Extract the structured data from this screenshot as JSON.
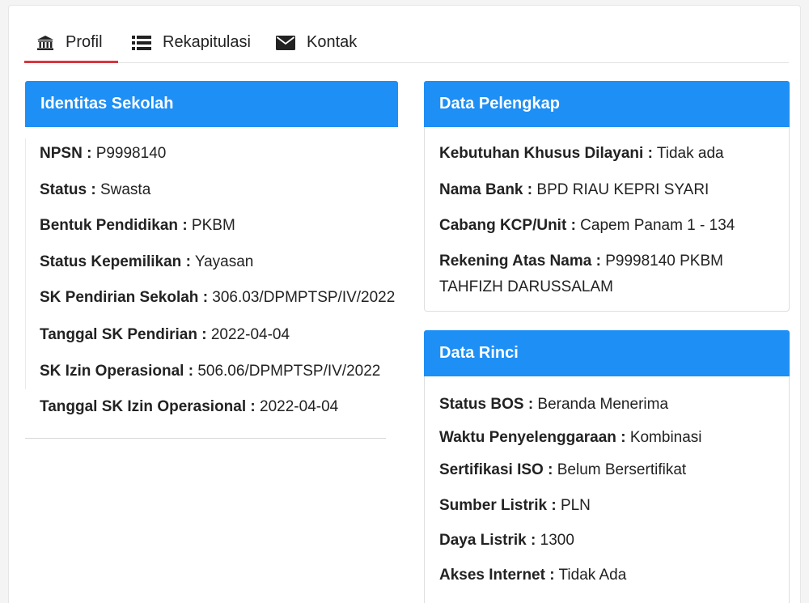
{
  "tabs": [
    {
      "label": "Profil",
      "icon": "bank-icon",
      "active": true
    },
    {
      "label": "Rekapitulasi",
      "icon": "list-icon",
      "active": false
    },
    {
      "label": "Kontak",
      "icon": "envelope-icon",
      "active": false
    }
  ],
  "colors": {
    "accent": "#1e8ff5",
    "active_tab": "#d9363e"
  },
  "identitas": {
    "title": "Identitas Sekolah",
    "fields": [
      {
        "label": "NPSN",
        "value": "P9998140"
      },
      {
        "label": "Status",
        "value": "Swasta"
      },
      {
        "label": "Bentuk Pendidikan",
        "value": "PKBM"
      },
      {
        "label": "Status Kepemilikan",
        "value": "Yayasan"
      },
      {
        "label": "SK Pendirian Sekolah",
        "value": "306.03/DPMPTSP/IV/2022"
      },
      {
        "label": "Tanggal SK Pendirian",
        "value": "2022-04-04"
      },
      {
        "label": "SK Izin Operasional",
        "value": "506.06/DPMPTSP/IV/2022"
      },
      {
        "label": "Tanggal SK Izin Operasional",
        "value": "2022-04-04"
      }
    ]
  },
  "pelengkap": {
    "title": "Data Pelengkap",
    "fields": [
      {
        "label": "Kebutuhan Khusus Dilayani",
        "value": "Tidak ada"
      },
      {
        "label": "Nama Bank",
        "value": "BPD RIAU KEPRI SYARI"
      },
      {
        "label": "Cabang KCP/Unit",
        "value": "Capem Panam 1 - 134"
      },
      {
        "label": "Rekening Atas Nama",
        "value": "P9998140 PKBM TAHFIZH DARUSSALAM"
      }
    ]
  },
  "rinci": {
    "title": "Data Rinci",
    "fields": [
      {
        "label": "Status BOS",
        "value": "Beranda Menerima"
      },
      {
        "label": "Waktu Penyelenggaraan",
        "value": "Kombinasi"
      },
      {
        "label": "Sertifikasi ISO",
        "value": "Belum Bersertifikat"
      },
      {
        "label": "Sumber Listrik",
        "value": "PLN"
      },
      {
        "label": "Daya Listrik",
        "value": "1300"
      },
      {
        "label": "Akses Internet",
        "value": "Tidak Ada"
      }
    ]
  }
}
